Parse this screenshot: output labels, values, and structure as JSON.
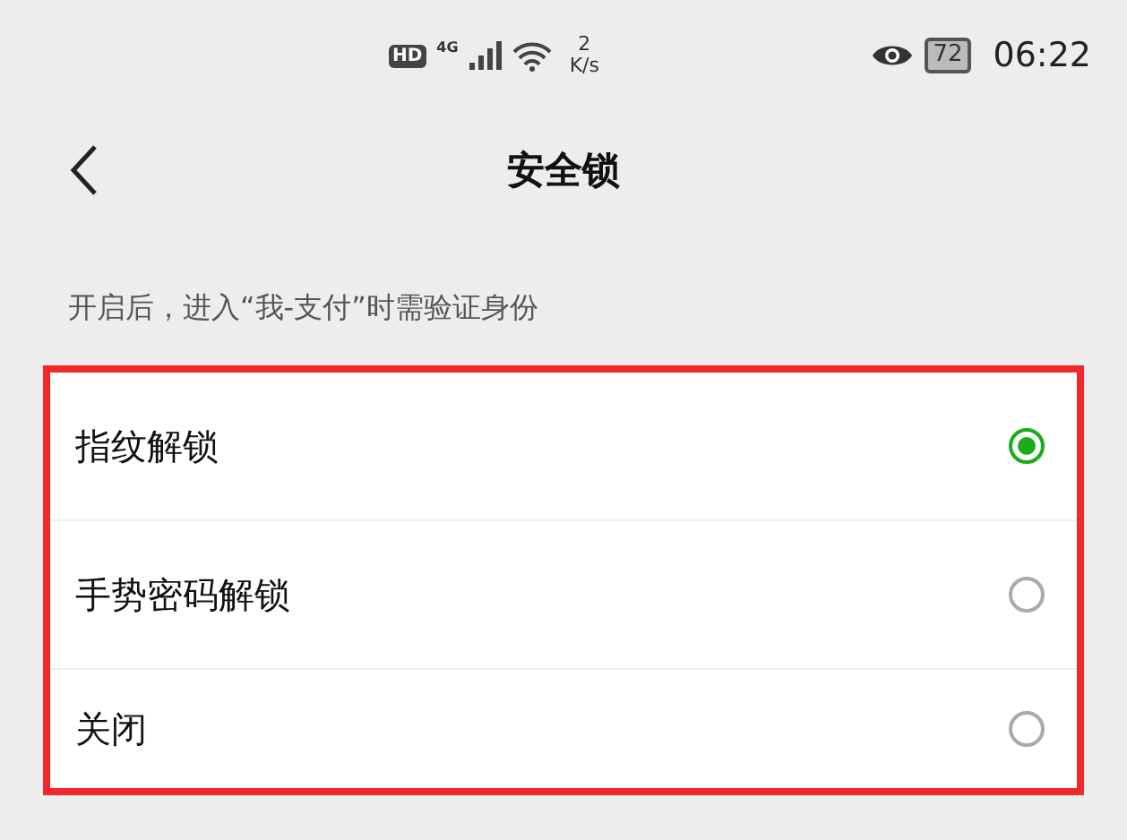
{
  "status_bar": {
    "hd_badge": "HD",
    "network": "4G",
    "speed_value": "2",
    "speed_unit": "K/s",
    "battery": "72",
    "time": "06:22"
  },
  "header": {
    "title": "安全锁"
  },
  "hint": "开启后，进入“我-支付”时需验证身份",
  "options": [
    {
      "label": "指纹解锁",
      "selected": true
    },
    {
      "label": "手势密码解锁",
      "selected": false
    },
    {
      "label": "关闭",
      "selected": false
    }
  ]
}
